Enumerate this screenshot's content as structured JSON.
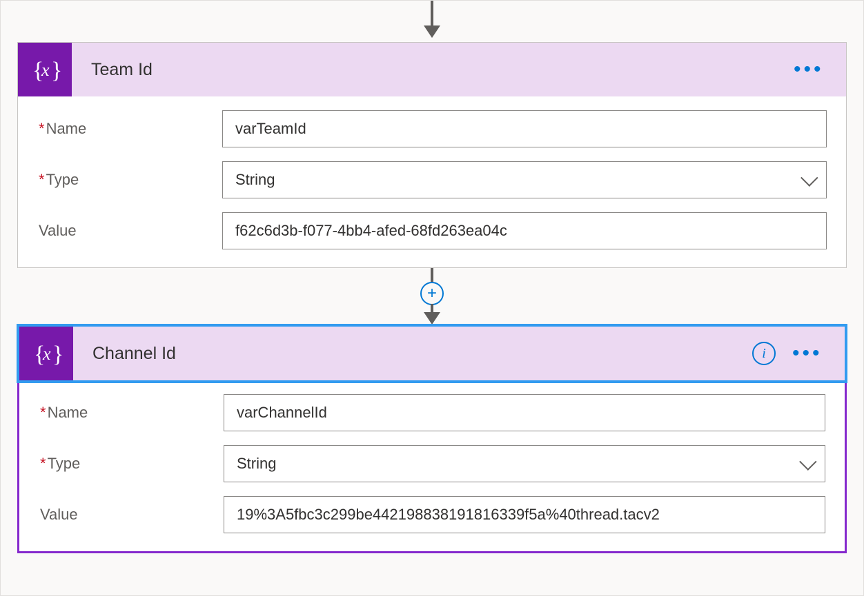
{
  "labels": {
    "name": "Name",
    "type": "Type",
    "value": "Value"
  },
  "plus_glyph": "+",
  "cards": {
    "team": {
      "title": "Team Id",
      "name_value": "varTeamId",
      "type_value": "String",
      "value_value": "f62c6d3b-f077-4bb4-afed-68fd263ea04c"
    },
    "channel": {
      "title": "Channel Id",
      "name_value": "varChannelId",
      "type_value": "String",
      "value_value": "19%3A5fbc3c299be442198838191816339f5a%40thread.tacv2"
    }
  }
}
